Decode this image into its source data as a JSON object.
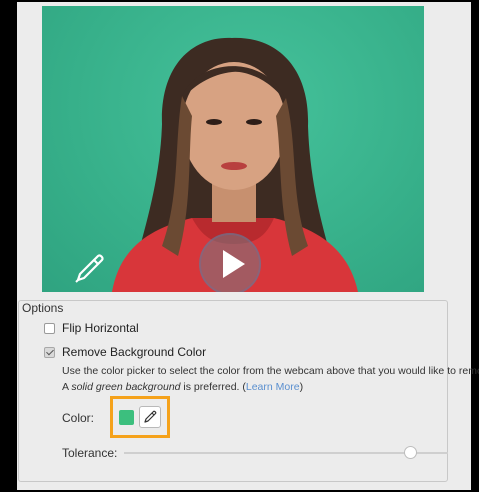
{
  "options": {
    "legend": "Options",
    "flip_horizontal": {
      "label": "Flip Horizontal",
      "checked": false
    },
    "remove_bg": {
      "label": "Remove Background Color",
      "checked": true
    },
    "desc_line1": "Use the color picker to select the color from the webcam above that you would like to remove.",
    "desc_line2_prefix": "A ",
    "desc_line2_em": "solid green background",
    "desc_line2_mid": " is preferred. (",
    "desc_line2_link": "Learn More",
    "desc_line2_suffix": ")",
    "color_label": "Color:",
    "tolerance_label": "Tolerance:",
    "tolerance_value": 0.88
  },
  "colors": {
    "green_screen": "#39b58f",
    "swatch": "#3cbf7e",
    "highlight": "#f5a21b",
    "link": "#5a8fcf"
  },
  "icons": {
    "play": "play-icon",
    "eyedropper": "eyedropper-icon"
  }
}
